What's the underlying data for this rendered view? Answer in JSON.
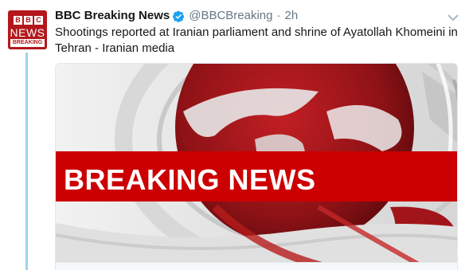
{
  "avatar": {
    "letters": [
      "B",
      "B",
      "C"
    ],
    "word": "NEWS",
    "strip": "BREAKING"
  },
  "tweet": {
    "display_name": "BBC Breaking News",
    "handle": "@BBCBreaking",
    "separator": "·",
    "time": "2h",
    "text": "Shootings reported at Iranian parliament and shrine of Ayatollah Khomeini in Tehran - Iranian media"
  },
  "card": {
    "banner_text": "BREAKING NEWS"
  },
  "icons": {
    "verified": "verified-badge-icon",
    "caret": "chevron-down-icon"
  },
  "colors": {
    "bbc_red": "#b3171b",
    "banner_red": "#cc0000",
    "verified_blue": "#1da1f2",
    "thread_line": "#9ed2e8",
    "muted_text": "#657786"
  }
}
